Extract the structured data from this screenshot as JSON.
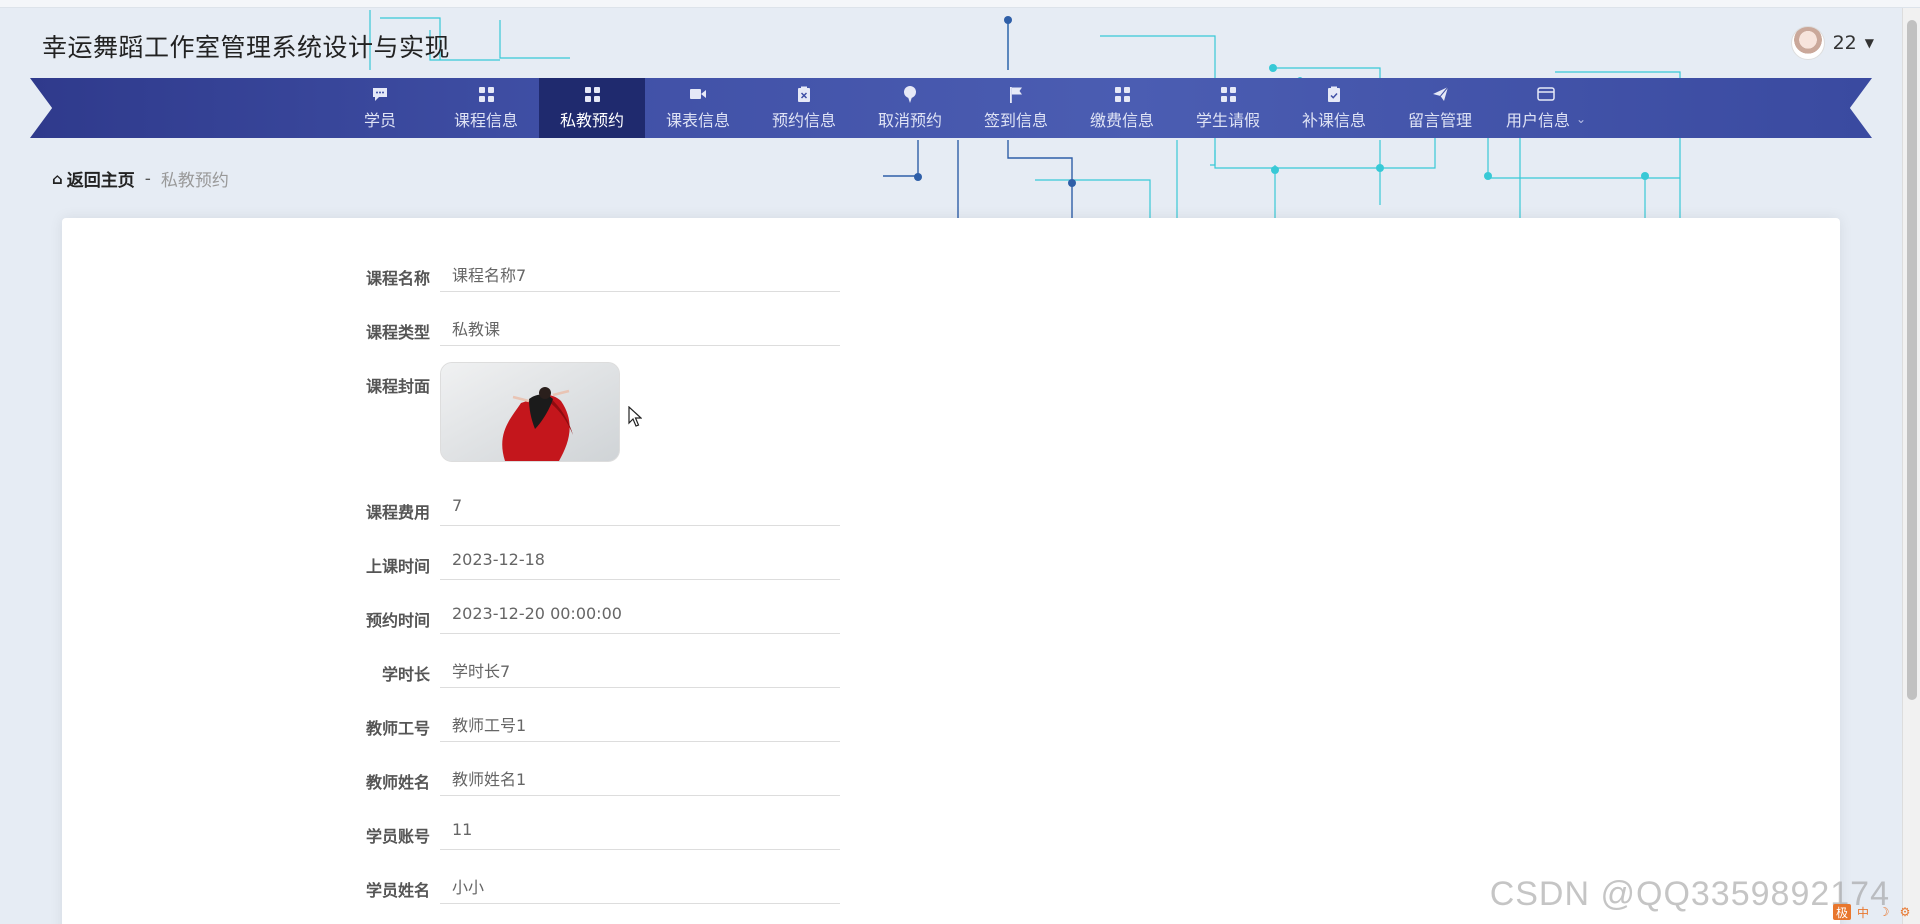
{
  "app": {
    "title": "幸运舞蹈工作室管理系统设计与实现"
  },
  "user": {
    "name": "22"
  },
  "nav": {
    "items": [
      {
        "label": "学员",
        "icon": "comment-icon"
      },
      {
        "label": "课程信息",
        "icon": "grid-icon"
      },
      {
        "label": "私教预约",
        "icon": "grid-icon",
        "active": true
      },
      {
        "label": "课表信息",
        "icon": "video-icon"
      },
      {
        "label": "预约信息",
        "icon": "clipboard-x-icon"
      },
      {
        "label": "取消预约",
        "icon": "pin-icon"
      },
      {
        "label": "签到信息",
        "icon": "flag-icon"
      },
      {
        "label": "缴费信息",
        "icon": "grid-icon"
      },
      {
        "label": "学生请假",
        "icon": "grid-icon"
      },
      {
        "label": "补课信息",
        "icon": "clipboard-check-icon"
      },
      {
        "label": "留言管理",
        "icon": "send-icon"
      },
      {
        "label": "用户信息",
        "icon": "card-icon"
      }
    ]
  },
  "breadcrumb": {
    "home": "返回主页",
    "separator": "-",
    "current": "私教预约"
  },
  "form": {
    "course_name": {
      "label": "课程名称",
      "value": "课程名称7"
    },
    "course_type": {
      "label": "课程类型",
      "value": "私教课"
    },
    "cover": {
      "label": "课程封面"
    },
    "fee": {
      "label": "课程费用",
      "value": "7"
    },
    "class_time": {
      "label": "上课时间",
      "value": "2023-12-18"
    },
    "booking_time": {
      "label": "预约时间",
      "value": "2023-12-20 00:00:00"
    },
    "duration": {
      "label": "学时长",
      "value": "学时长7"
    },
    "teacher_id": {
      "label": "教师工号",
      "value": "教师工号1"
    },
    "teacher_name": {
      "label": "教师姓名",
      "value": "教师姓名1"
    },
    "student_account": {
      "label": "学员账号",
      "value": "11"
    },
    "student_name": {
      "label": "学员姓名",
      "value": "小小"
    }
  },
  "watermark": "CSDN @QQ3359892174",
  "colors": {
    "nav_bg": "#4050a6",
    "nav_active": "#1f2a6e",
    "circuit": "#2ec5d3"
  }
}
